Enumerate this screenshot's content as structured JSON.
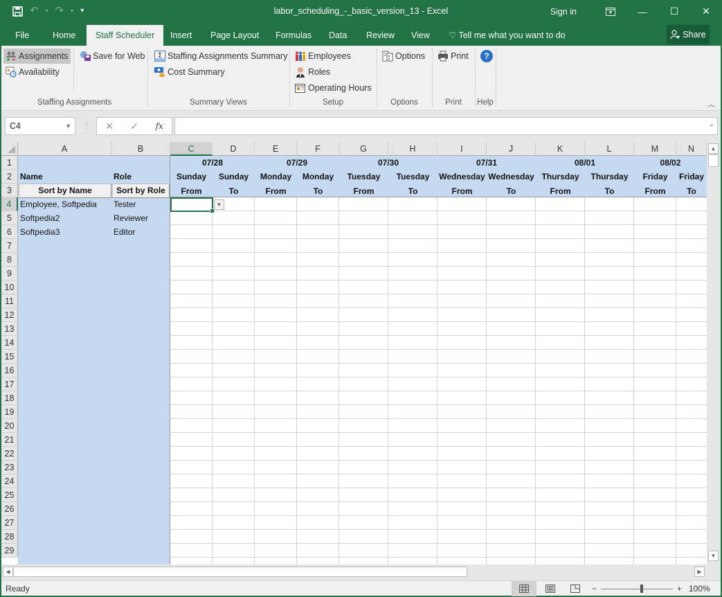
{
  "window": {
    "title": "labor_scheduling_-_basic_version_13 - Excel",
    "sign_in": "Sign in",
    "controls": {
      "ribbon_display": "⊡",
      "minimize": "—",
      "maximize": "☐",
      "close": "✕"
    }
  },
  "qat": {
    "save": "💾",
    "undo": "↶",
    "redo": "↷",
    "customize": "⩡"
  },
  "tabs": [
    {
      "label": "File"
    },
    {
      "label": "Home"
    },
    {
      "label": "Staff Scheduler",
      "active": true
    },
    {
      "label": "Insert"
    },
    {
      "label": "Page Layout"
    },
    {
      "label": "Formulas"
    },
    {
      "label": "Data"
    },
    {
      "label": "Review"
    },
    {
      "label": "View"
    }
  ],
  "tell_me": "Tell me what you want to do",
  "share": "Share",
  "ribbon": {
    "groups": [
      {
        "label": "Staffing Assignments",
        "buttons": [
          "Assignments",
          "Availability",
          "Save for Web"
        ]
      },
      {
        "label": "Summary Views",
        "buttons": [
          "Staffing Assignments Summary",
          "Cost Summary"
        ]
      },
      {
        "label": "Setup",
        "buttons": [
          "Employees",
          "Roles",
          "Operating Hours"
        ]
      },
      {
        "label": "Options",
        "buttons": [
          "Options"
        ]
      },
      {
        "label": "Print",
        "buttons": [
          "Print"
        ]
      },
      {
        "label": "Help",
        "buttons": [
          "?"
        ]
      }
    ]
  },
  "formula_bar": {
    "name_box": "C4",
    "cancel": "✕",
    "enter": "✓",
    "fx": "fx",
    "value": ""
  },
  "sheet": {
    "columns": [
      "A",
      "B",
      "C",
      "D",
      "E",
      "F",
      "G",
      "H",
      "I",
      "J",
      "K",
      "L",
      "M",
      "N"
    ],
    "selected_column": "C",
    "rows": [
      "1",
      "2",
      "3",
      "4",
      "5",
      "6",
      "7",
      "8",
      "9",
      "10",
      "11",
      "12",
      "13",
      "14",
      "15",
      "16",
      "17",
      "18",
      "19",
      "20",
      "21",
      "22",
      "23",
      "24",
      "25",
      "26",
      "27",
      "28",
      "29"
    ],
    "selected_row": "4",
    "headers": {
      "name": "Name",
      "role": "Role",
      "sort_by_name": "Sort by Name",
      "sort_by_role": "Sort by Role"
    },
    "dates": [
      "07/28",
      "07/29",
      "07/30",
      "07/31",
      "08/01",
      "08/02"
    ],
    "days": [
      "Sunday",
      "Sunday",
      "Monday",
      "Monday",
      "Tuesday",
      "Tuesday",
      "Wednesday",
      "Wednesday",
      "Thursday",
      "Thursday",
      "Friday",
      "Friday"
    ],
    "from_to": [
      "From",
      "To",
      "From",
      "To",
      "From",
      "To",
      "From",
      "To",
      "From",
      "To",
      "From",
      "To"
    ],
    "employees": [
      {
        "name": "Employee, Softpedia",
        "role": "Tester"
      },
      {
        "name": "Softpedia2",
        "role": "Reviewer"
      },
      {
        "name": "Softpedia3",
        "role": "Editor"
      }
    ]
  },
  "status": {
    "text": "Ready",
    "zoom": "100%",
    "zoom_minus": "−",
    "zoom_plus": "+"
  }
}
